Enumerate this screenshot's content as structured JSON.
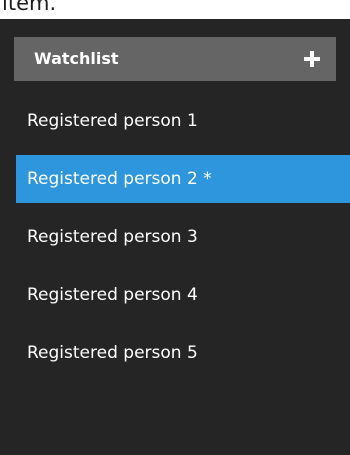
{
  "page_top_text": "item.",
  "watchlist": {
    "title": "Watchlist",
    "add_icon": "plus-icon",
    "selected_index": 1,
    "accent_color": "#2d96dc",
    "items": [
      {
        "label": "Registered person 1"
      },
      {
        "label": "Registered person 2 *"
      },
      {
        "label": "Registered person 3"
      },
      {
        "label": "Registered person 4"
      },
      {
        "label": "Registered person 5"
      }
    ]
  }
}
